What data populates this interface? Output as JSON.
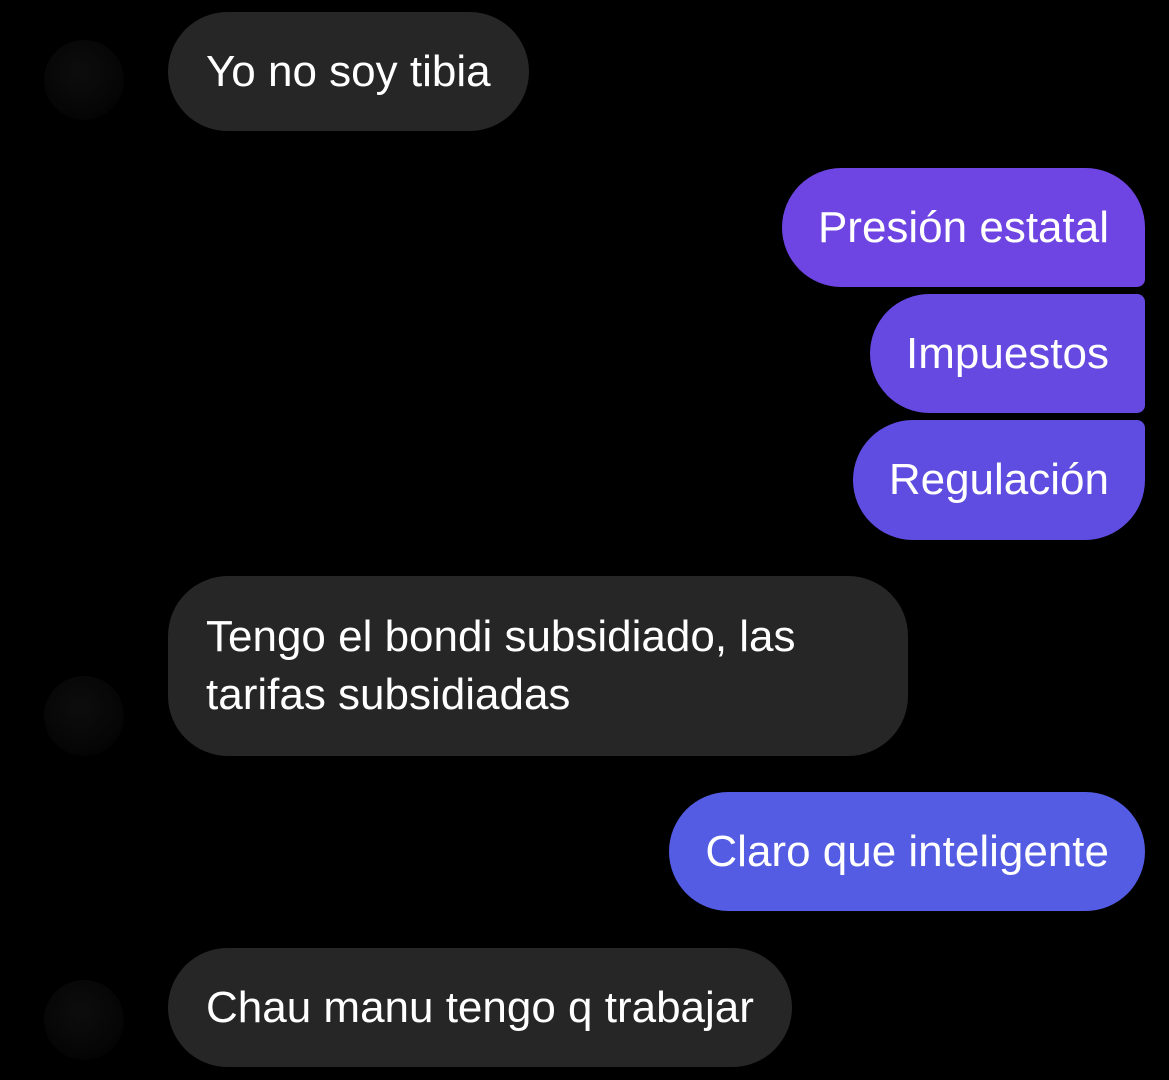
{
  "messages": [
    {
      "direction": "incoming",
      "text": "Yo no soy tibia"
    },
    {
      "direction": "outgoing",
      "text": "Presión estatal",
      "color": "#6E45E2"
    },
    {
      "direction": "outgoing",
      "text": "Impuestos",
      "color": "#6549E1"
    },
    {
      "direction": "outgoing",
      "text": "Regulación",
      "color": "#5E4DE0"
    },
    {
      "direction": "incoming",
      "lines": [
        "Tengo el bondi subsidiado, las",
        "tarifas subsidiadas"
      ]
    },
    {
      "direction": "outgoing",
      "text": "Claro que inteligente",
      "color": "#535CE3"
    },
    {
      "direction": "incoming",
      "text": "Chau manu tengo q trabajar"
    }
  ],
  "colors": {
    "background": "#000000",
    "incoming_bubble": "#262626",
    "text": "#FFFFFF"
  }
}
